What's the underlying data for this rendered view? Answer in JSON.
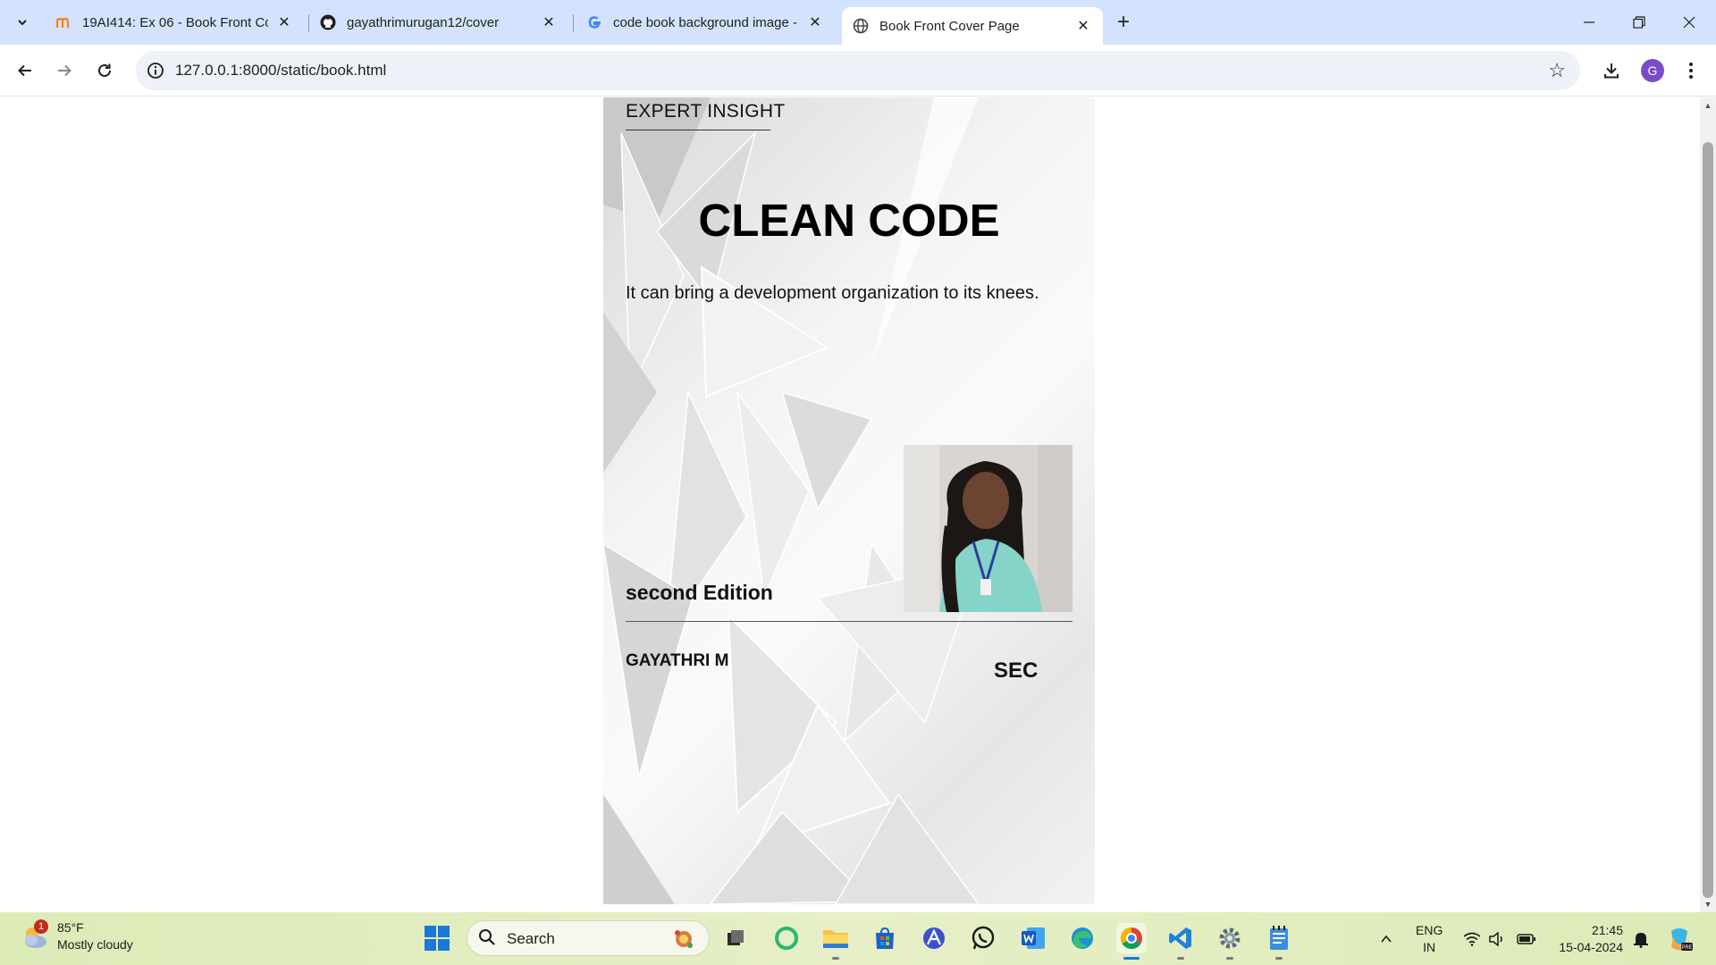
{
  "browser": {
    "tabs": [
      {
        "title": "19AI414: Ex 06 - Book Front Co",
        "favicon": "moodle-icon",
        "active": false
      },
      {
        "title": "gayathrimurugan12/cover",
        "favicon": "github-icon",
        "active": false
      },
      {
        "title": "code book background image -",
        "favicon": "google-icon",
        "active": false
      },
      {
        "title": "Book Front Cover Page",
        "favicon": "globe-icon",
        "active": true
      }
    ],
    "address": "127.0.0.1:8000/static/book.html",
    "profile_initial": "G"
  },
  "cover": {
    "series": "EXPERT INSIGHT",
    "title": "CLEAN CODE",
    "tagline": "It can bring a development organization to its knees.",
    "edition": "second Edition",
    "author": "GAYATHRI M",
    "publisher": "SEC"
  },
  "taskbar": {
    "weather": {
      "temp": "85°F",
      "condition": "Mostly cloudy",
      "badge": "1"
    },
    "search_placeholder": "Search",
    "apps": [
      "file-explorer-icon",
      "task-view-icon",
      "copilot-icon",
      "folder-icon",
      "store-icon",
      "ai-app-icon",
      "whatsapp-icon",
      "word-icon",
      "edge-icon",
      "chrome-icon",
      "vscode-icon",
      "settings-icon",
      "notepad-icon"
    ],
    "language": {
      "line1": "ENG",
      "line2": "IN"
    },
    "clock": {
      "time": "21:45",
      "date": "15-04-2024"
    }
  },
  "colors": {
    "tabstrip": "#d3e3fd",
    "taskbar": "#e6efc6",
    "accent": "#1a73e8"
  }
}
